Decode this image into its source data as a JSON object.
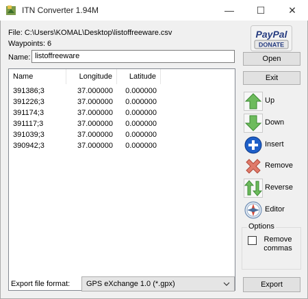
{
  "window": {
    "title": "ITN Converter 1.94M",
    "minimize_glyph": "—",
    "maximize_glyph": "☐",
    "close_glyph": "✕"
  },
  "file_info": {
    "file_line": "File: C:\\Users\\KOMAL\\Desktop\\listoffreeware.csv",
    "waypoints_line": "Waypoints: 6"
  },
  "name_field": {
    "label": "Name:",
    "value": "listoffreeware"
  },
  "table": {
    "columns": [
      "Name",
      "Longitude",
      "Latitude"
    ],
    "rows": [
      {
        "name": "391386;3",
        "longitude": "37.000000",
        "latitude": "0.000000"
      },
      {
        "name": "391226;3",
        "longitude": "37.000000",
        "latitude": "0.000000"
      },
      {
        "name": "391174;3",
        "longitude": "37.000000",
        "latitude": "0.000000"
      },
      {
        "name": "391117;3",
        "longitude": "37.000000",
        "latitude": "0.000000"
      },
      {
        "name": "391039;3",
        "longitude": "37.000000",
        "latitude": "0.000000"
      },
      {
        "name": "390942;3",
        "longitude": "37.000000",
        "latitude": "0.000000"
      }
    ]
  },
  "paypal": {
    "line1": "PayPal",
    "line2": "DONATE"
  },
  "buttons": {
    "open": "Open",
    "exit": "Exit",
    "export": "Export"
  },
  "side_actions": [
    {
      "label": "Up",
      "icon": "arrow-up-icon"
    },
    {
      "label": "Down",
      "icon": "arrow-down-icon"
    },
    {
      "label": "Insert",
      "icon": "plus-icon"
    },
    {
      "label": "Remove",
      "icon": "x-icon"
    },
    {
      "label": "Reverse",
      "icon": "reverse-icon"
    },
    {
      "label": "Editor",
      "icon": "compass-icon"
    }
  ],
  "options": {
    "legend": "Options",
    "remove_commas_line1": "Remove",
    "remove_commas_line2": "commas",
    "remove_commas_checked": false
  },
  "export": {
    "label": "Export file format:",
    "selected_format": "GPS eXchange 1.0 (*.gpx)"
  },
  "colors": {
    "paypal_blue": "#253b80",
    "paypal_light": "#179bd7",
    "arrow_green": "#4caf50",
    "insert_blue": "#1e5fc8",
    "remove_red": "#e07a6a"
  }
}
